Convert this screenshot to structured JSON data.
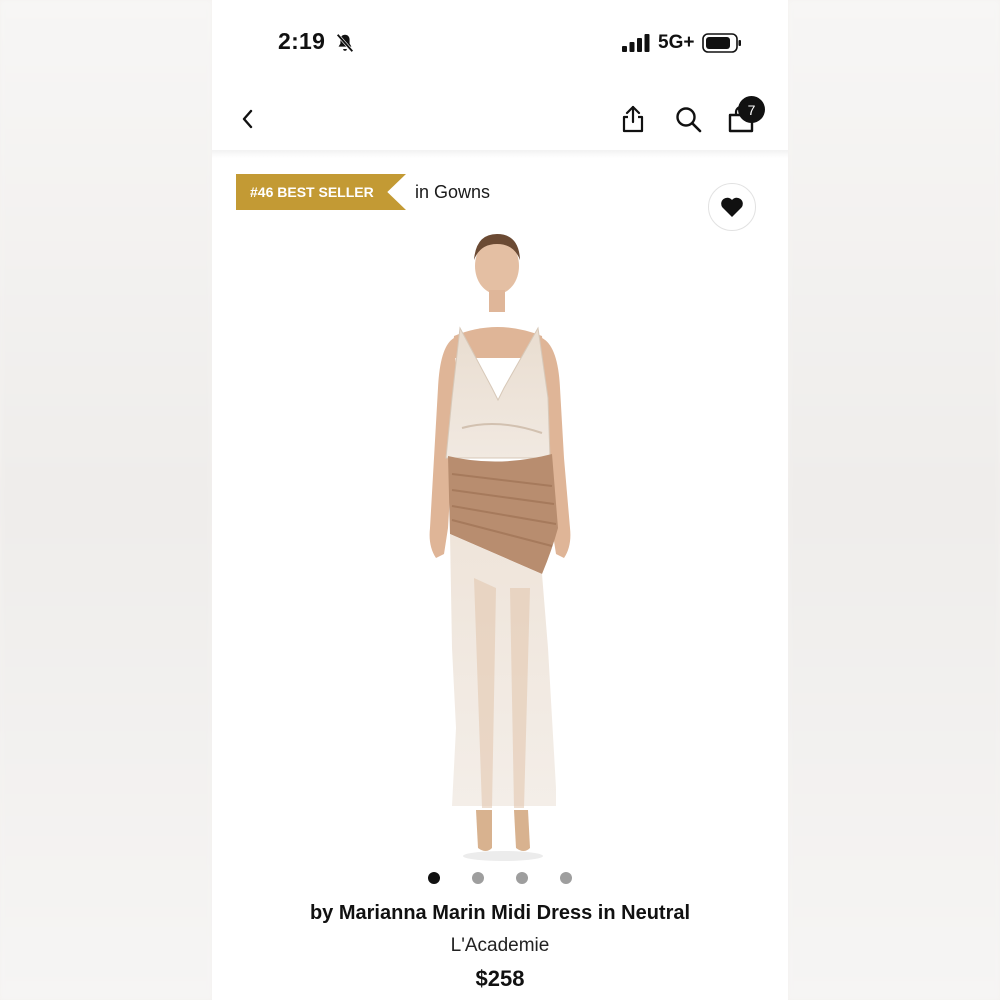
{
  "status_bar": {
    "time": "2:19",
    "network": "5G+"
  },
  "nav": {
    "back_icon": "chevron-left-icon",
    "share_icon": "share-icon",
    "search_icon": "search-icon",
    "bag_icon": "shopping-bag-icon",
    "cart_count": "7"
  },
  "ranking": {
    "badge": "#46 BEST SELLER",
    "category": "in Gowns",
    "badge_color": "#c39a34"
  },
  "favorite_icon": "heart-icon",
  "gallery": {
    "image_count": 4,
    "active_index": 0
  },
  "product": {
    "title": "by Marianna Marin Midi Dress in Neutral",
    "brand": "L'Academie",
    "price": "$258"
  }
}
